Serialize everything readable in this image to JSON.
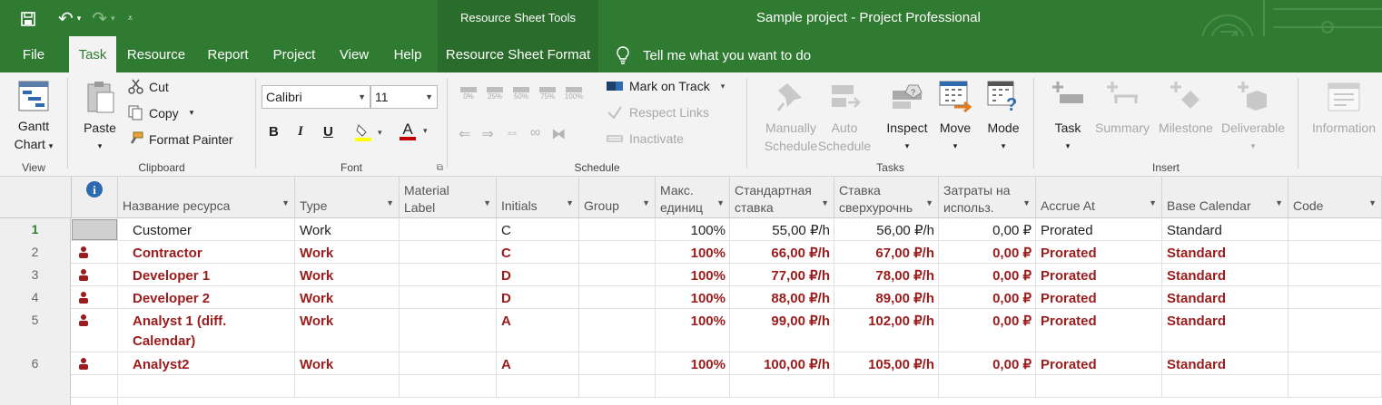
{
  "title": {
    "contextual_tab_group": "Resource Sheet Tools",
    "app_title": "Sample project  -  Project Professional"
  },
  "tabs": [
    {
      "label": "File"
    },
    {
      "label": "Task"
    },
    {
      "label": "Resource"
    },
    {
      "label": "Report"
    },
    {
      "label": "Project"
    },
    {
      "label": "View"
    },
    {
      "label": "Help"
    },
    {
      "label": "Resource Sheet Format"
    }
  ],
  "tell_me": "Tell me what you want to do",
  "ribbon": {
    "view": {
      "gantt_line1": "Gantt",
      "gantt_line2": "Chart",
      "label": "View"
    },
    "clipboard": {
      "paste": "Paste",
      "cut": "Cut",
      "copy": "Copy",
      "format_painter": "Format Painter",
      "label": "Clipboard"
    },
    "font": {
      "font_name": "Calibri",
      "font_size": "11",
      "bold": "B",
      "italic": "I",
      "underline": "U",
      "font_color_letter": "A",
      "label": "Font"
    },
    "schedule": {
      "pct": [
        "0%",
        "25%",
        "50%",
        "75%",
        "100%"
      ],
      "mark_on_track": "Mark on Track",
      "respect_links": "Respect Links",
      "inactivate": "Inactivate",
      "label": "Schedule"
    },
    "tasks": {
      "manually_line1": "Manually",
      "manually_line2": "Schedule",
      "auto_line1": "Auto",
      "auto_line2": "Schedule",
      "inspect": "Inspect",
      "move": "Move",
      "mode": "Mode",
      "label": "Tasks"
    },
    "insert": {
      "task": "Task",
      "summary": "Summary",
      "milestone": "Milestone",
      "deliverable": "Deliverable",
      "label": "Insert"
    },
    "properties": {
      "information": "Information"
    }
  },
  "sheet": {
    "headers": {
      "info": "i",
      "name": "Название ресурса",
      "type": "Type",
      "material_line1": "Material",
      "material_line2": "Label",
      "initials": "Initials",
      "group": "Group",
      "max_line1": "Макс.",
      "max_line2": "единиц",
      "std_line1": "Стандартная",
      "std_line2": "ставка",
      "ovt_line1": "Ставка",
      "ovt_line2": "сверхурочнь",
      "cost_line1": "Затраты на",
      "cost_line2": "использ.",
      "accrue": "Accrue At",
      "calendar": "Base Calendar",
      "code": "Code"
    },
    "rows": [
      {
        "num": "1",
        "name": "Customer",
        "type": "Work",
        "initials": "C",
        "max": "100%",
        "std": "55,00 ₽/h",
        "ovt": "56,00 ₽/h",
        "cost": "0,00 ₽",
        "accrue": "Prorated",
        "calendar": "Standard"
      },
      {
        "num": "2",
        "name": "Contractor",
        "type": "Work",
        "initials": "C",
        "max": "100%",
        "std": "66,00 ₽/h",
        "ovt": "67,00 ₽/h",
        "cost": "0,00 ₽",
        "accrue": "Prorated",
        "calendar": "Standard"
      },
      {
        "num": "3",
        "name": "Developer 1",
        "type": "Work",
        "initials": "D",
        "max": "100%",
        "std": "77,00 ₽/h",
        "ovt": "78,00 ₽/h",
        "cost": "0,00 ₽",
        "accrue": "Prorated",
        "calendar": "Standard"
      },
      {
        "num": "4",
        "name": "Developer 2",
        "type": "Work",
        "initials": "D",
        "max": "100%",
        "std": "88,00 ₽/h",
        "ovt": "89,00 ₽/h",
        "cost": "0,00 ₽",
        "accrue": "Prorated",
        "calendar": "Standard"
      },
      {
        "num": "5",
        "name_line1": "Analyst 1 (diff.",
        "name_line2": "Calendar)",
        "type": "Work",
        "initials": "A",
        "max": "100%",
        "std": "99,00 ₽/h",
        "ovt": "102,00 ₽/h",
        "cost": "0,00 ₽",
        "accrue": "Prorated",
        "calendar": "Standard"
      },
      {
        "num": "6",
        "name": "Analyst2",
        "type": "Work",
        "initials": "A",
        "max": "100%",
        "std": "100,00 ₽/h",
        "ovt": "105,00 ₽/h",
        "cost": "0,00 ₽",
        "accrue": "Prorated",
        "calendar": "Standard"
      }
    ]
  },
  "colors": {
    "accent": "#2f7b31",
    "overallocated": "#9b1c1c"
  }
}
